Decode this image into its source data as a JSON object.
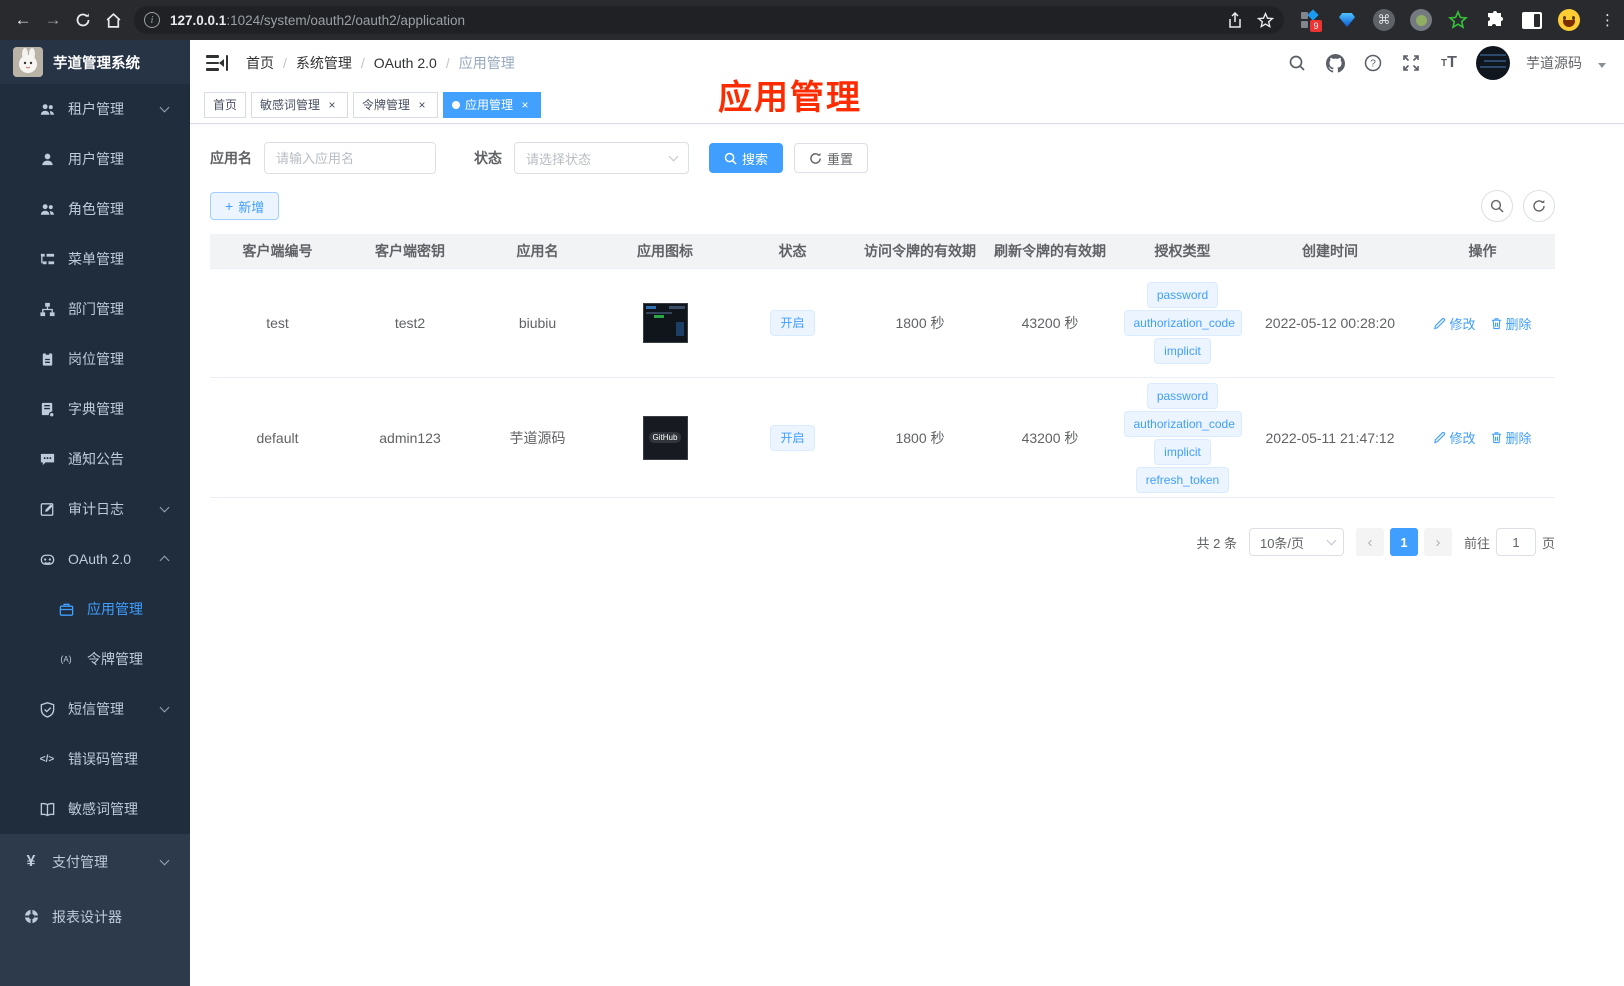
{
  "browser": {
    "url_host": "127.0.0.1",
    "url_rest": ":1024/system/oauth2/oauth2/application",
    "extension_badge": "9"
  },
  "sidebar": {
    "logo_title": "芋道管理系统",
    "menu": [
      {
        "label": "租户管理",
        "icon": "users-icon",
        "arrow": "down",
        "level": "group"
      },
      {
        "label": "用户管理",
        "icon": "user-icon",
        "level": "group"
      },
      {
        "label": "角色管理",
        "icon": "users-icon",
        "level": "group"
      },
      {
        "label": "菜单管理",
        "icon": "tree-icon",
        "level": "group"
      },
      {
        "label": "部门管理",
        "icon": "org-icon",
        "level": "group"
      },
      {
        "label": "岗位管理",
        "icon": "badge-icon",
        "level": "group"
      },
      {
        "label": "字典管理",
        "icon": "dict-icon",
        "level": "group"
      },
      {
        "label": "通知公告",
        "icon": "message-icon",
        "level": "group"
      },
      {
        "label": "审计日志",
        "icon": "log-icon",
        "arrow": "down",
        "level": "group"
      },
      {
        "label": "OAuth 2.0",
        "icon": "robot-icon",
        "arrow": "up",
        "level": "group"
      },
      {
        "label": "应用管理",
        "icon": "briefcase-icon",
        "level": "sub",
        "active": true
      },
      {
        "label": "令牌管理",
        "icon": "token-icon",
        "level": "sub"
      },
      {
        "label": "短信管理",
        "icon": "shield-icon",
        "arrow": "down",
        "level": "group"
      },
      {
        "label": "错误码管理",
        "icon": "code-icon",
        "level": "group"
      },
      {
        "label": "敏感词管理",
        "icon": "book-icon",
        "level": "group"
      },
      {
        "label": "支付管理",
        "icon": "yen-icon",
        "arrow": "down",
        "level": "top"
      },
      {
        "label": "报表设计器",
        "icon": "wheel-icon",
        "level": "top"
      }
    ]
  },
  "header": {
    "breadcrumb": [
      "首页",
      "系统管理",
      "OAuth 2.0",
      "应用管理"
    ],
    "user_name": "芋道源码",
    "annotation": "应用管理"
  },
  "tabs": [
    {
      "label": "首页",
      "closable": false,
      "active": false
    },
    {
      "label": "敏感词管理",
      "closable": true,
      "active": false
    },
    {
      "label": "令牌管理",
      "closable": true,
      "active": false
    },
    {
      "label": "应用管理",
      "closable": true,
      "active": true
    }
  ],
  "filters": {
    "name_label": "应用名",
    "name_placeholder": "请输入应用名",
    "status_label": "状态",
    "status_placeholder": "请选择状态",
    "search_label": "搜索",
    "reset_label": "重置",
    "add_label": "新增"
  },
  "table": {
    "columns": [
      "客户端编号",
      "客户端密钥",
      "应用名",
      "应用图标",
      "状态",
      "访问令牌的有效期",
      "刷新令牌的有效期",
      "授权类型",
      "创建时间",
      "操作"
    ],
    "rows": [
      {
        "client_id": "test",
        "secret": "test2",
        "name": "biubiu",
        "icon_label": "",
        "status": "开启",
        "access": "1800 秒",
        "refresh": "43200 秒",
        "grants": [
          "password",
          "authorization_code",
          "implicit"
        ],
        "created": "2022-05-12 00:28:20"
      },
      {
        "client_id": "default",
        "secret": "admin123",
        "name": "芋道源码",
        "icon_label": "GitHub",
        "status": "开启",
        "access": "1800 秒",
        "refresh": "43200 秒",
        "grants": [
          "password",
          "authorization_code",
          "implicit",
          "refresh_token"
        ],
        "created": "2022-05-11 21:47:12"
      }
    ],
    "edit_label": "修改",
    "delete_label": "删除"
  },
  "pagination": {
    "total_text": "共 2 条",
    "page_size": "10条/页",
    "current_page": "1",
    "goto_label": "前往",
    "goto_value": "1",
    "page_unit": "页"
  },
  "colors": {
    "accent": "#409eff",
    "annotation_red": "#ff2b00",
    "sidebar_bg": "#2d3a4b",
    "submenu_bg": "#1f2d3d"
  }
}
